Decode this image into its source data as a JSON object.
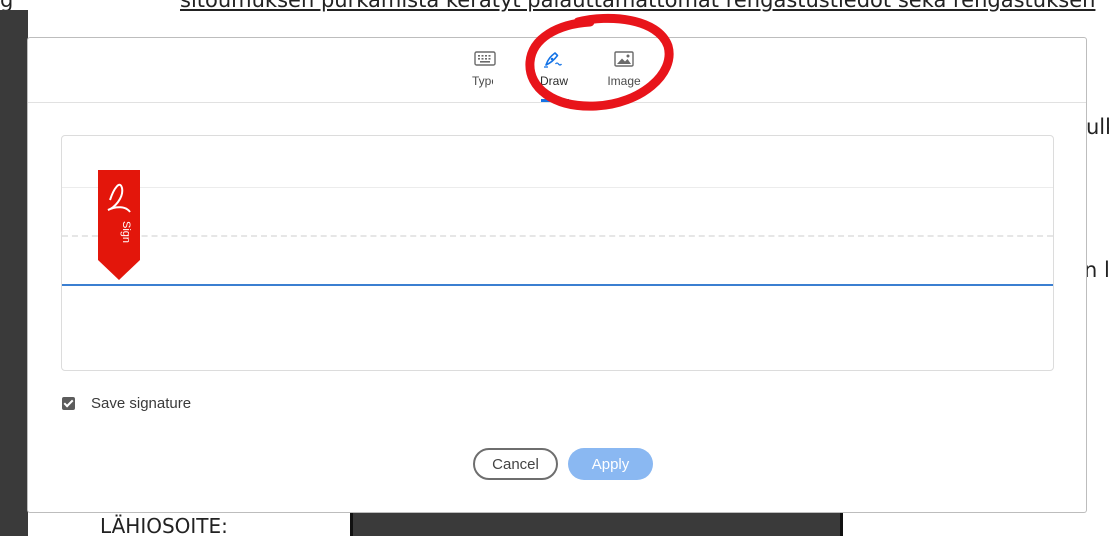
{
  "document": {
    "top_line_left": "g",
    "top_line": "sitoumuksen purkamista kerätyt palauttamattomat rengastustiedot sekä rengastuksen",
    "fragment_right_1": "ulk",
    "fragment_right_2": "n l",
    "bottom_label": "LÄHIOSOITE:"
  },
  "dialog": {
    "tabs": [
      {
        "label": "Type",
        "icon": "keyboard-icon"
      },
      {
        "label": "Draw",
        "icon": "pen-draw-icon"
      },
      {
        "label": "Image",
        "icon": "image-icon"
      }
    ],
    "active_tab": "Draw",
    "sign_flag_label": "Sign",
    "save_signature_label": "Save signature",
    "save_signature_checked": true,
    "cancel_label": "Cancel",
    "apply_label": "Apply"
  },
  "colors": {
    "accent": "#1473e6",
    "annotation": "#e8141a",
    "sign_flag": "#e3160b",
    "apply_disabled": "#8ab8f2"
  }
}
